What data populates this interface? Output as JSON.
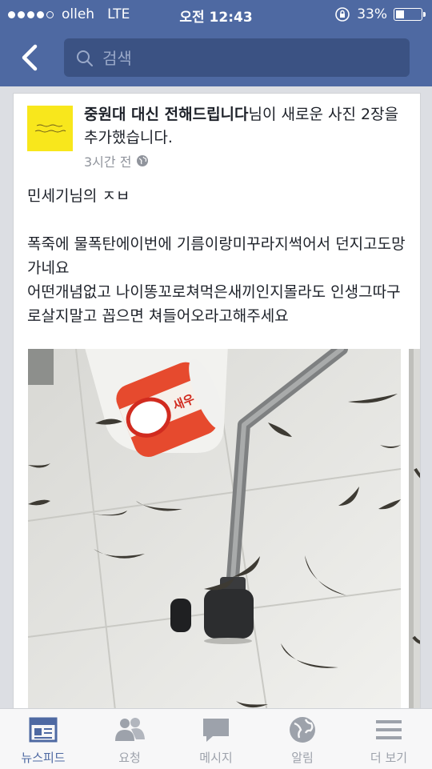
{
  "status": {
    "carrier": "olleh",
    "network": "LTE",
    "time": "오전 12:43",
    "battery": "33%",
    "battery_level": 0.33
  },
  "search": {
    "placeholder": "검색"
  },
  "post": {
    "page_name": "중원대 대신 전해드립니다",
    "action": "님이 새로운 사진 2장을 추가했습니다.",
    "time": "3시간 전",
    "body_line1": "민세기님의 ㅈㅂ",
    "body_line2": "폭죽에 물폭탄에이번에 기름이랑미꾸라지썩어서 던지고도망가네요",
    "body_line3": "어떤개념없고 나이똥꼬로쳐먹은새끼인지몰라도 인생그따구로살지말고 꼽으면  쳐들어오라고해주세요"
  },
  "tabs": [
    {
      "label": "뉴스피드",
      "icon": "news-feed-icon"
    },
    {
      "label": "요청",
      "icon": "friend-requests-icon"
    },
    {
      "label": "메시지",
      "icon": "messages-icon"
    },
    {
      "label": "알림",
      "icon": "notifications-globe-icon"
    },
    {
      "label": "더 보기",
      "icon": "more-menu-icon"
    }
  ],
  "colors": {
    "brand": "#4e69a2",
    "search_bg": "#3b5283",
    "active_tab": "#4e69a2",
    "inactive_tab": "#9da2ab"
  }
}
